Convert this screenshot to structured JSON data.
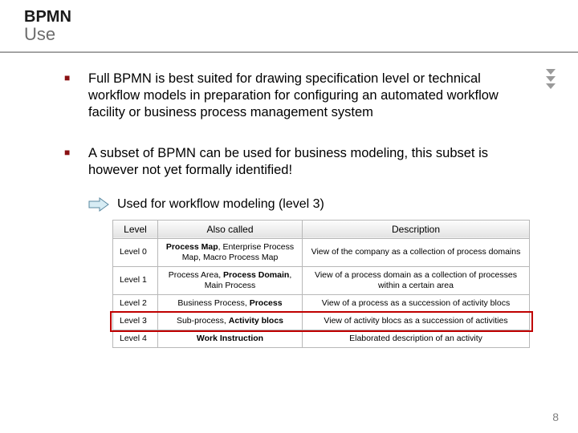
{
  "title": {
    "line1": "BPMN",
    "line2": "Use"
  },
  "bullets": [
    "Full BPMN is best suited for drawing specification level or technical workflow models in preparation for configuring an automated workflow facility or business process management system",
    "A subset of BPMN can be used for business modeling, this subset is however not yet formally identified!"
  ],
  "arrow_text": "Used for workflow modeling (level 3)",
  "table": {
    "headers": [
      "Level",
      "Also called",
      "Description"
    ],
    "rows": [
      {
        "level": "Level 0",
        "also": {
          "pre": "",
          "bold": "Process Map",
          "post": ", Enterprise Process Map, Macro Process Map"
        },
        "desc": "View of the company as a collection of process domains"
      },
      {
        "level": "Level 1",
        "also": {
          "pre": "Process Area, ",
          "bold": "Process Domain",
          "post": ", Main Process"
        },
        "desc": "View  of a process domain as a collection of processes within a certain area"
      },
      {
        "level": "Level 2",
        "also": {
          "pre": "Business Process, ",
          "bold": "Process",
          "post": ""
        },
        "desc": "View of a process as a succession of activity blocs"
      },
      {
        "level": "Level 3",
        "also": {
          "pre": "Sub-process, ",
          "bold": "Activity blocs",
          "post": ""
        },
        "desc": "View of activity blocs as a succession of activities",
        "highlight": true
      },
      {
        "level": "Level 4",
        "also": {
          "pre": "",
          "bold": "Work Instruction",
          "post": ""
        },
        "desc": "Elaborated description of an activity"
      }
    ]
  },
  "page_number": "8"
}
